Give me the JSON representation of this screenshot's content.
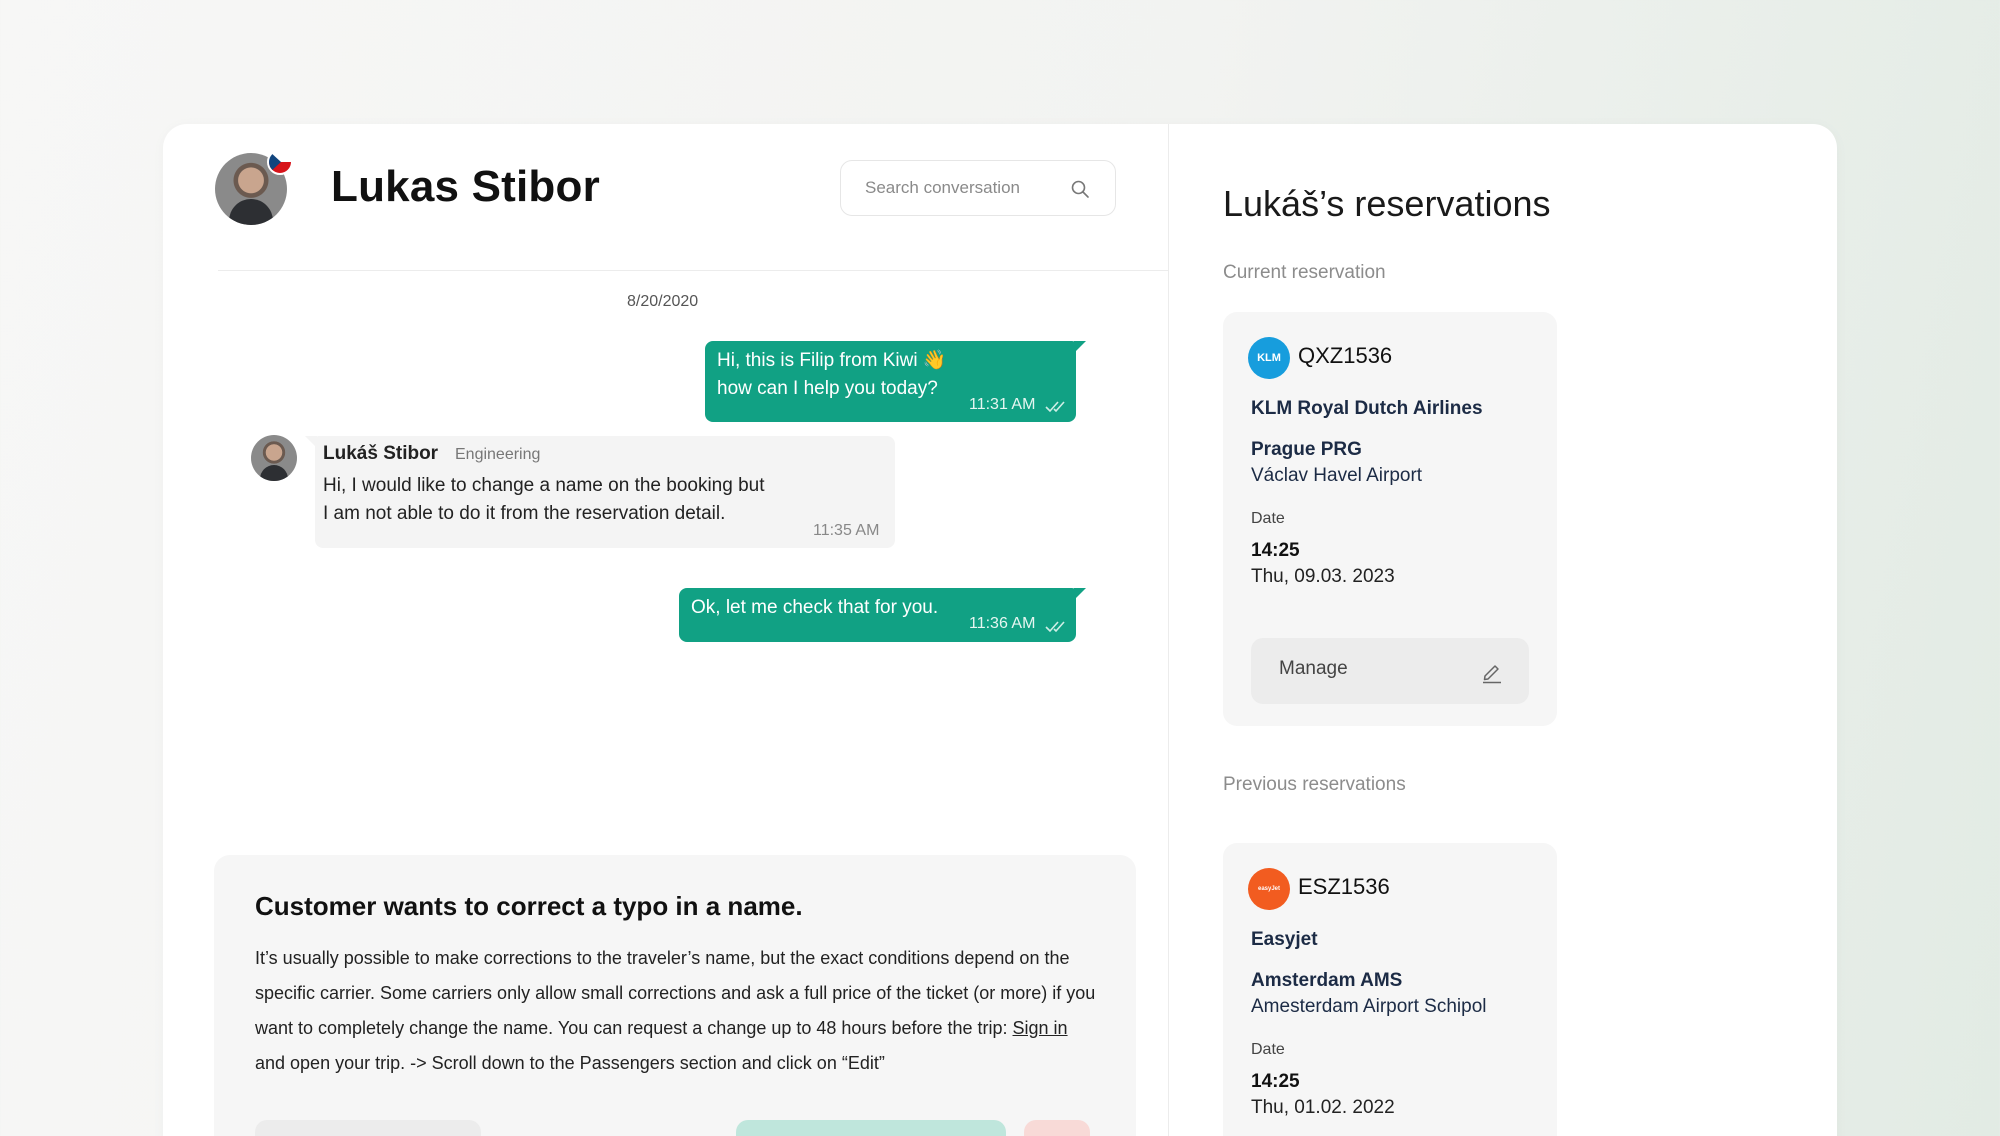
{
  "chat": {
    "contact_name": "Lukas Stibor",
    "search_placeholder": "Search conversation",
    "date_separator": "8/20/2020",
    "messages": [
      {
        "direction": "out",
        "line1": "Hi, this is Filip from Kiwi 👋",
        "line2": "how can I help you today?",
        "time": "11:31 AM",
        "status_icon": "double-check-icon"
      },
      {
        "direction": "in",
        "sender": "Lukáš Stibor",
        "department": "Engineering",
        "line1": "Hi, I would like to change a name on the booking but",
        "line2": "I am not able to do it from the reservation detail.",
        "time": "11:35 AM"
      },
      {
        "direction": "out",
        "line1": "Ok, let me check that for you.",
        "time": "11:36 AM",
        "status_icon": "double-check-icon"
      }
    ]
  },
  "suggestion": {
    "title": "Customer wants to correct a typo in a name.",
    "body_before_link": "It’s usually possible to make corrections to the traveler’s name, but the exact conditions depend on the specific carrier. Some carriers only allow small corrections and ask a full price of the ticket (or more) if you want to completely change the name. You can request a change up to 48 hours before the trip: ",
    "link_text": "Sign in",
    "body_after_link": " and open your trip. -> Scroll down to the Passengers section and click on “Edit”"
  },
  "reservations": {
    "title": "Lukáš’s reservations",
    "current_label": "Current reservation",
    "previous_label": "Previous reservations",
    "current": {
      "logo_text": "KLM",
      "code": "QXZ1536",
      "airline": "KLM Royal Dutch Airlines",
      "city": "Prague PRG",
      "airport": "Václav Havel Airport",
      "date_label": "Date",
      "time": "14:25",
      "date": "Thu, 09.03. 2023",
      "manage_label": "Manage"
    },
    "previous": [
      {
        "logo_text": "easyJet",
        "code": "ESZ1536",
        "airline": "Easyjet",
        "city": "Amsterdam AMS",
        "airport": "Amesterdam Airport Schipol",
        "date_label": "Date",
        "time": "14:25",
        "date": "Thu, 01.02. 2022"
      }
    ]
  },
  "colors": {
    "accent_green": "#11a184",
    "klm_blue": "#179ddd",
    "easyjet_orange": "#f25c20"
  }
}
